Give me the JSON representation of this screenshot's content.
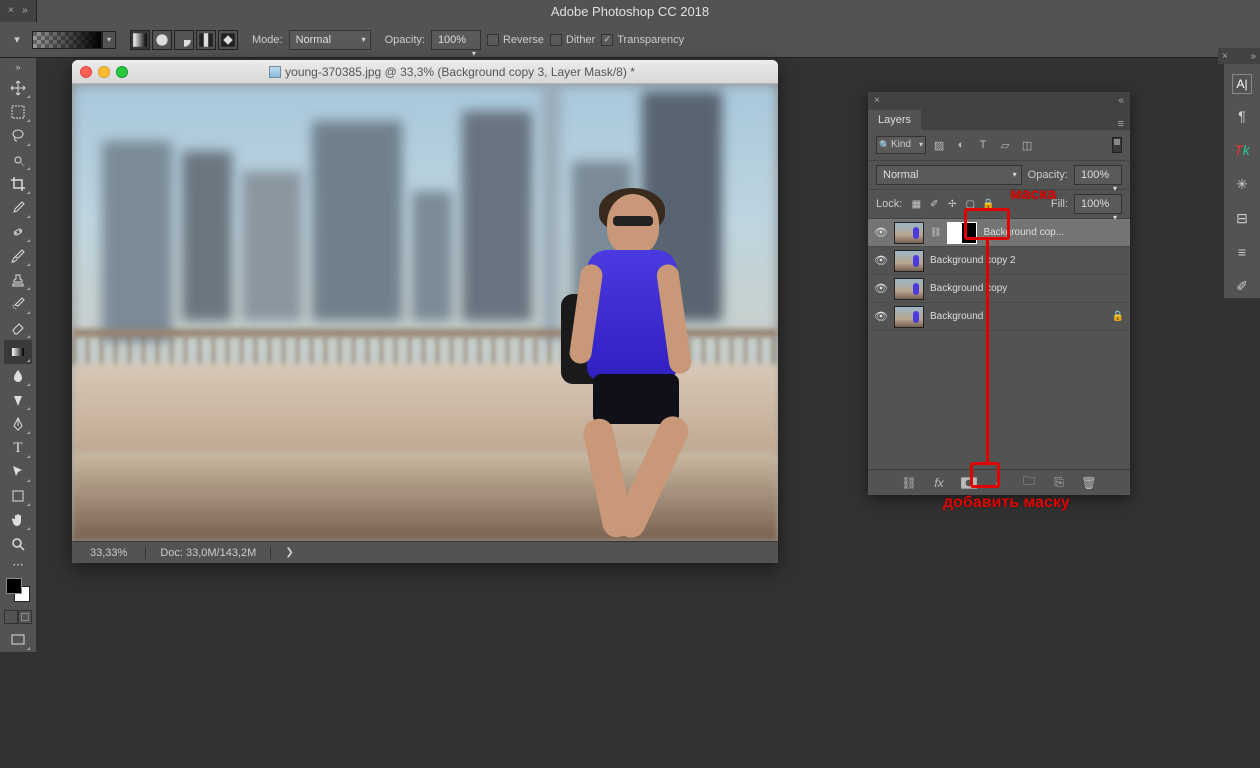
{
  "app_title": "Adobe Photoshop CC 2018",
  "options": {
    "mode_label": "Mode:",
    "mode_value": "Normal",
    "opacity_label": "Opacity:",
    "opacity_value": "100%",
    "reverse_label": "Reverse",
    "dither_label": "Dither",
    "transparency_label": "Transparency",
    "transparency_checked": "✓"
  },
  "document": {
    "title": "young-370385.jpg @ 33,3% (Background copy 3, Layer Mask/8) *",
    "zoom": "33,33%",
    "doc_info": "Doc: 33,0M/143,2M"
  },
  "layers_panel": {
    "title": "Layers",
    "filter_kind": "Kind",
    "blend_mode": "Normal",
    "opacity_label": "Opacity:",
    "opacity_value": "100%",
    "lock_label": "Lock:",
    "fill_label": "Fill:",
    "fill_value": "100%",
    "layers": [
      {
        "name": "Background cop...",
        "has_mask": true,
        "selected": true,
        "locked": false
      },
      {
        "name": "Background copy 2",
        "has_mask": false,
        "selected": false,
        "locked": false
      },
      {
        "name": "Background copy",
        "has_mask": false,
        "selected": false,
        "locked": false
      },
      {
        "name": "Background",
        "has_mask": false,
        "selected": false,
        "locked": true
      }
    ]
  },
  "annotations": {
    "mask_label": "маска",
    "add_mask_label": "добавить маску"
  },
  "right_tabs_close": "×",
  "mini_tab_close": "×"
}
